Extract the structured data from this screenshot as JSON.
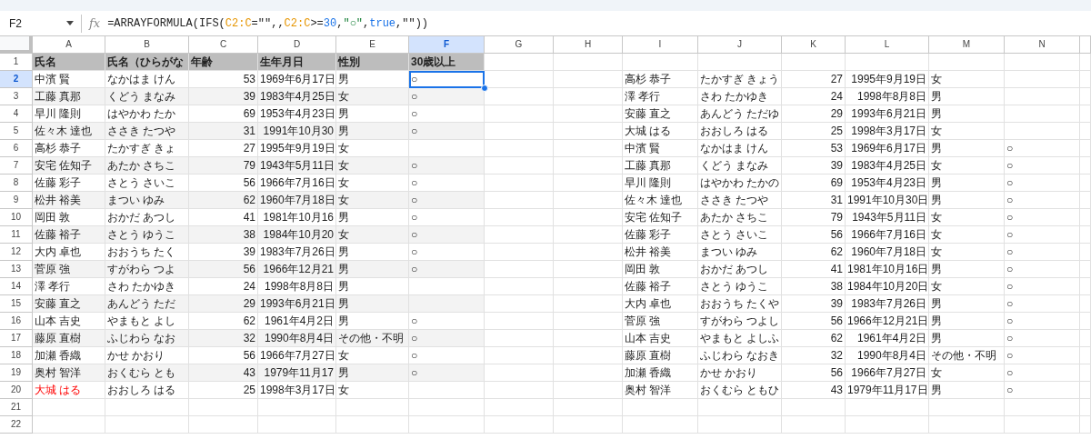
{
  "formula_bar": {
    "cell_ref": "F2",
    "fx_label": "fx",
    "formula": [
      {
        "kind": "plain",
        "text": "=ARRAYFORMULA(IFS("
      },
      {
        "kind": "range",
        "text": "C2:C"
      },
      {
        "kind": "plain",
        "text": "=\"\",,"
      },
      {
        "kind": "range",
        "text": "C2:C"
      },
      {
        "kind": "plain",
        "text": ">="
      },
      {
        "kind": "number",
        "text": "30"
      },
      {
        "kind": "plain",
        "text": ","
      },
      {
        "kind": "string",
        "text": "\"○\""
      },
      {
        "kind": "plain",
        "text": ","
      },
      {
        "kind": "bool",
        "text": "true"
      },
      {
        "kind": "plain",
        "text": ",\"\"))"
      }
    ]
  },
  "columns": [
    {
      "label": "A",
      "selected": false
    },
    {
      "label": "B",
      "selected": false
    },
    {
      "label": "C",
      "selected": false
    },
    {
      "label": "D",
      "selected": false
    },
    {
      "label": "E",
      "selected": false
    },
    {
      "label": "F",
      "selected": true
    },
    {
      "label": "G",
      "selected": false
    },
    {
      "label": "H",
      "selected": false
    },
    {
      "label": "I",
      "selected": false
    },
    {
      "label": "J",
      "selected": false
    },
    {
      "label": "K",
      "selected": false
    },
    {
      "label": "L",
      "selected": false
    },
    {
      "label": "M",
      "selected": false
    },
    {
      "label": "N",
      "selected": false
    }
  ],
  "row_numbers": [
    {
      "label": "1",
      "selected": false
    },
    {
      "label": "2",
      "selected": true
    },
    {
      "label": "3",
      "selected": false
    },
    {
      "label": "4",
      "selected": false
    },
    {
      "label": "5",
      "selected": false
    },
    {
      "label": "6",
      "selected": false
    },
    {
      "label": "7",
      "selected": false
    },
    {
      "label": "8",
      "selected": false
    },
    {
      "label": "9",
      "selected": false
    },
    {
      "label": "10",
      "selected": false
    },
    {
      "label": "11",
      "selected": false
    },
    {
      "label": "12",
      "selected": false
    },
    {
      "label": "13",
      "selected": false
    },
    {
      "label": "14",
      "selected": false
    },
    {
      "label": "15",
      "selected": false
    },
    {
      "label": "16",
      "selected": false
    },
    {
      "label": "17",
      "selected": false
    },
    {
      "label": "18",
      "selected": false
    },
    {
      "label": "19",
      "selected": false
    },
    {
      "label": "20",
      "selected": false
    },
    {
      "label": "21",
      "selected": false
    },
    {
      "label": "22",
      "selected": false
    }
  ],
  "left_table": {
    "headers": [
      "氏名",
      "氏名（ひらがな",
      "年齢",
      "生年月日",
      "性別",
      "30歳以上"
    ],
    "rows": [
      {
        "name": "中濱 賢",
        "kana": "なかはま けん",
        "age": "53",
        "birthdate": "1969年6月17日",
        "gender": "男",
        "over_30": "○",
        "flagged": false
      },
      {
        "name": "工藤 真那",
        "kana": "くどう まなみ",
        "age": "39",
        "birthdate": "1983年4月25日",
        "gender": "女",
        "over_30": "○",
        "flagged": false
      },
      {
        "name": "早川 隆則",
        "kana": "はやかわ たか",
        "age": "69",
        "birthdate": "1953年4月23日",
        "gender": "男",
        "over_30": "○",
        "flagged": false
      },
      {
        "name": "佐々木 達也",
        "kana": "ささき たつや",
        "age": "31",
        "birthdate": "1991年10月30",
        "gender": "男",
        "over_30": "○",
        "flagged": false
      },
      {
        "name": "高杉 恭子",
        "kana": "たかすぎ きょ",
        "age": "27",
        "birthdate": "1995年9月19日",
        "gender": "女",
        "flagged": false
      },
      {
        "name": "安宅 佐知子",
        "kana": "あたか さちこ",
        "age": "79",
        "birthdate": "1943年5月11日",
        "gender": "女",
        "over_30": "○",
        "flagged": false
      },
      {
        "name": "佐藤 彩子",
        "kana": "さとう さいこ",
        "age": "56",
        "birthdate": "1966年7月16日",
        "gender": "女",
        "over_30": "○",
        "flagged": false
      },
      {
        "name": "松井 裕美",
        "kana": "まつい ゆみ",
        "age": "62",
        "birthdate": "1960年7月18日",
        "gender": "女",
        "over_30": "○",
        "flagged": false
      },
      {
        "name": "岡田 敦",
        "kana": "おかだ あつし",
        "age": "41",
        "birthdate": "1981年10月16",
        "gender": "男",
        "over_30": "○",
        "flagged": false
      },
      {
        "name": "佐藤 裕子",
        "kana": "さとう ゆうこ",
        "age": "38",
        "birthdate": "1984年10月20",
        "gender": "女",
        "over_30": "○",
        "flagged": false
      },
      {
        "name": "大内 卓也",
        "kana": "おおうち たく",
        "age": "39",
        "birthdate": "1983年7月26日",
        "gender": "男",
        "over_30": "○",
        "flagged": false
      },
      {
        "name": "菅原 強",
        "kana": "すがわら つよ",
        "age": "56",
        "birthdate": "1966年12月21",
        "gender": "男",
        "over_30": "○",
        "flagged": false
      },
      {
        "name": "澤 孝行",
        "kana": "さわ たかゆき",
        "age": "24",
        "birthdate": "1998年8月8日",
        "gender": "男",
        "flagged": false
      },
      {
        "name": "安藤 直之",
        "kana": "あんどう ただ",
        "age": "29",
        "birthdate": "1993年6月21日",
        "gender": "男",
        "flagged": false
      },
      {
        "name": "山本 吉史",
        "kana": "やまもと よし",
        "age": "62",
        "birthdate": "1961年4月2日",
        "gender": "男",
        "over_30": "○",
        "flagged": false
      },
      {
        "name": "藤原 直樹",
        "kana": "ふじわら なお",
        "age": "32",
        "birthdate": "1990年8月4日",
        "gender": "その他・不明",
        "over_30": "○",
        "flagged": false
      },
      {
        "name": "加瀬 香織",
        "kana": "かせ かおり",
        "age": "56",
        "birthdate": "1966年7月27日",
        "gender": "女",
        "over_30": "○",
        "flagged": false
      },
      {
        "name": "奥村 智洋",
        "kana": "おくむら とも",
        "age": "43",
        "birthdate": "1979年11月17",
        "gender": "男",
        "over_30": "○",
        "flagged": false
      },
      {
        "name": "大城 はる",
        "kana": "おおしろ はる",
        "age": "25",
        "birthdate": "1998年3月17日",
        "gender": "女",
        "flagged": true
      }
    ]
  },
  "right_table": {
    "rows": [
      {
        "name": "高杉 恭子",
        "kana": "たかすぎ きょう",
        "age": "27",
        "birthdate": "1995年9月19日",
        "gender": "女"
      },
      {
        "name": "澤 孝行",
        "kana": "さわ たかゆき",
        "age": "24",
        "birthdate": "1998年8月8日",
        "gender": "男"
      },
      {
        "name": "安藤 直之",
        "kana": "あんどう ただゆ",
        "age": "29",
        "birthdate": "1993年6月21日",
        "gender": "男"
      },
      {
        "name": "大城 はる",
        "kana": "おおしろ はる",
        "age": "25",
        "birthdate": "1998年3月17日",
        "gender": "女"
      },
      {
        "name": "中濱 賢",
        "kana": "なかはま けん",
        "age": "53",
        "birthdate": "1969年6月17日",
        "gender": "男",
        "over_30": "○"
      },
      {
        "name": "工藤 真那",
        "kana": "くどう まなみ",
        "age": "39",
        "birthdate": "1983年4月25日",
        "gender": "女",
        "over_30": "○"
      },
      {
        "name": "早川 隆則",
        "kana": "はやかわ たかの",
        "age": "69",
        "birthdate": "1953年4月23日",
        "gender": "男",
        "over_30": "○"
      },
      {
        "name": "佐々木 達也",
        "kana": "ささき たつや",
        "age": "31",
        "birthdate": "1991年10月30日",
        "gender": "男",
        "over_30": "○"
      },
      {
        "name": "安宅 佐知子",
        "kana": "あたか さちこ",
        "age": "79",
        "birthdate": "1943年5月11日",
        "gender": "女",
        "over_30": "○"
      },
      {
        "name": "佐藤 彩子",
        "kana": "さとう さいこ",
        "age": "56",
        "birthdate": "1966年7月16日",
        "gender": "女",
        "over_30": "○"
      },
      {
        "name": "松井 裕美",
        "kana": "まつい ゆみ",
        "age": "62",
        "birthdate": "1960年7月18日",
        "gender": "女",
        "over_30": "○"
      },
      {
        "name": "岡田 敦",
        "kana": "おかだ あつし",
        "age": "41",
        "birthdate": "1981年10月16日",
        "gender": "男",
        "over_30": "○"
      },
      {
        "name": "佐藤 裕子",
        "kana": "さとう ゆうこ",
        "age": "38",
        "birthdate": "1984年10月20日",
        "gender": "女",
        "over_30": "○"
      },
      {
        "name": "大内 卓也",
        "kana": "おおうち たくや",
        "age": "39",
        "birthdate": "1983年7月26日",
        "gender": "男",
        "over_30": "○"
      },
      {
        "name": "菅原 強",
        "kana": "すがわら つよし",
        "age": "56",
        "birthdate": "1966年12月21日",
        "gender": "男",
        "over_30": "○"
      },
      {
        "name": "山本 吉史",
        "kana": "やまもと よしふ",
        "age": "62",
        "birthdate": "1961年4月2日",
        "gender": "男",
        "over_30": "○"
      },
      {
        "name": "藤原 直樹",
        "kana": "ふじわら なおき",
        "age": "32",
        "birthdate": "1990年8月4日",
        "gender": "その他・不明",
        "over_30": "○"
      },
      {
        "name": "加瀬 香織",
        "kana": "かせ かおり",
        "age": "56",
        "birthdate": "1966年7月27日",
        "gender": "女",
        "over_30": "○"
      },
      {
        "name": "奥村 智洋",
        "kana": "おくむら ともひ",
        "age": "43",
        "birthdate": "1979年11月17日",
        "gender": "男",
        "over_30": "○"
      }
    ]
  }
}
